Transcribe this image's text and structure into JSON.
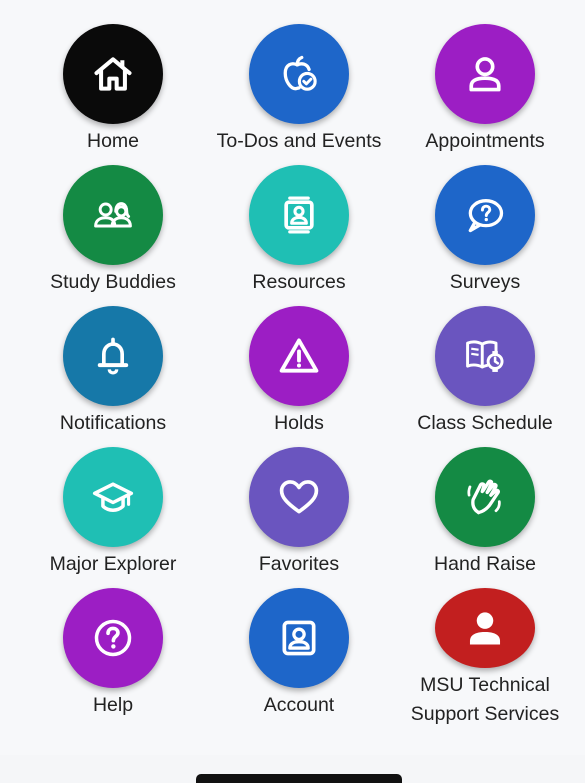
{
  "colors": {
    "home": "#0a0a0a",
    "todos": "#1e66c9",
    "appointments": "#9c1ec4",
    "study_buddies": "#148a44",
    "resources": "#1fbfb4",
    "surveys": "#1e66c9",
    "notifications": "#1678a8",
    "holds": "#9c1ec4",
    "class_schedule": "#6a55bf",
    "major_explorer": "#1fbfb4",
    "favorites": "#6a55bf",
    "hand_raise": "#148a44",
    "help": "#9c1ec4",
    "account": "#1e66c9",
    "support": "#c21f1f"
  },
  "tiles": [
    {
      "key": "home",
      "label": "Home",
      "icon": "house-icon"
    },
    {
      "key": "todos",
      "label": "To-Dos and Events",
      "icon": "apple-check-icon"
    },
    {
      "key": "appointments",
      "label": "Appointments",
      "icon": "person-icon"
    },
    {
      "key": "study_buddies",
      "label": "Study Buddies",
      "icon": "people-icon"
    },
    {
      "key": "resources",
      "label": "Resources",
      "icon": "profile-card-icon"
    },
    {
      "key": "surveys",
      "label": "Surveys",
      "icon": "question-bubble-icon"
    },
    {
      "key": "notifications",
      "label": "Notifications",
      "icon": "bell-icon"
    },
    {
      "key": "holds",
      "label": "Holds",
      "icon": "warning-icon"
    },
    {
      "key": "class_schedule",
      "label": "Class Schedule",
      "icon": "book-clock-icon"
    },
    {
      "key": "major_explorer",
      "label": "Major Explorer",
      "icon": "graduation-cap-icon"
    },
    {
      "key": "favorites",
      "label": "Favorites",
      "icon": "heart-icon"
    },
    {
      "key": "hand_raise",
      "label": "Hand Raise",
      "icon": "hand-wave-icon"
    },
    {
      "key": "help",
      "label": "Help",
      "icon": "help-icon"
    },
    {
      "key": "account",
      "label": "Account",
      "icon": "account-portrait-icon"
    },
    {
      "key": "support",
      "label": "MSU Technical Support Services",
      "label_line1": "MSU Technical",
      "label_line2": "Support Services",
      "icon": "user-solid-icon"
    }
  ]
}
